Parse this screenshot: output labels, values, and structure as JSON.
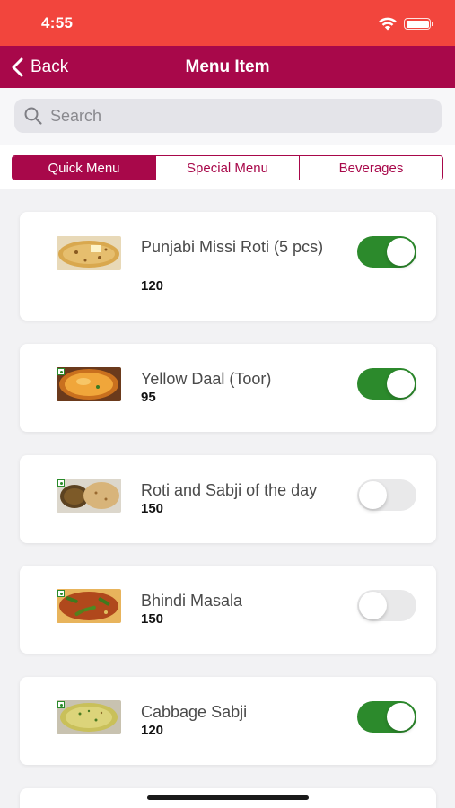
{
  "status_bar": {
    "time": "4:55"
  },
  "nav": {
    "back_label": "Back",
    "title": "Menu Item"
  },
  "search": {
    "placeholder": "Search",
    "value": ""
  },
  "segments": [
    {
      "label": "Quick Menu",
      "active": true
    },
    {
      "label": "Special Menu",
      "active": false
    },
    {
      "label": "Beverages",
      "active": false
    }
  ],
  "menu_items": [
    {
      "name": "Punjabi Missi Roti (5 pcs)",
      "price": "120",
      "enabled": true
    },
    {
      "name": "Yellow Daal (Toor)",
      "price": "95",
      "enabled": true
    },
    {
      "name": "Roti and Sabji of the day",
      "price": "150",
      "enabled": false
    },
    {
      "name": "Bhindi Masala",
      "price": "150",
      "enabled": false
    },
    {
      "name": "Cabbage Sabji",
      "price": "120",
      "enabled": true
    }
  ],
  "colors": {
    "status_bar": "#f2453d",
    "nav_bar": "#a8084a",
    "toggle_on": "#2c8a2c",
    "toggle_off": "#e9e9ea"
  }
}
